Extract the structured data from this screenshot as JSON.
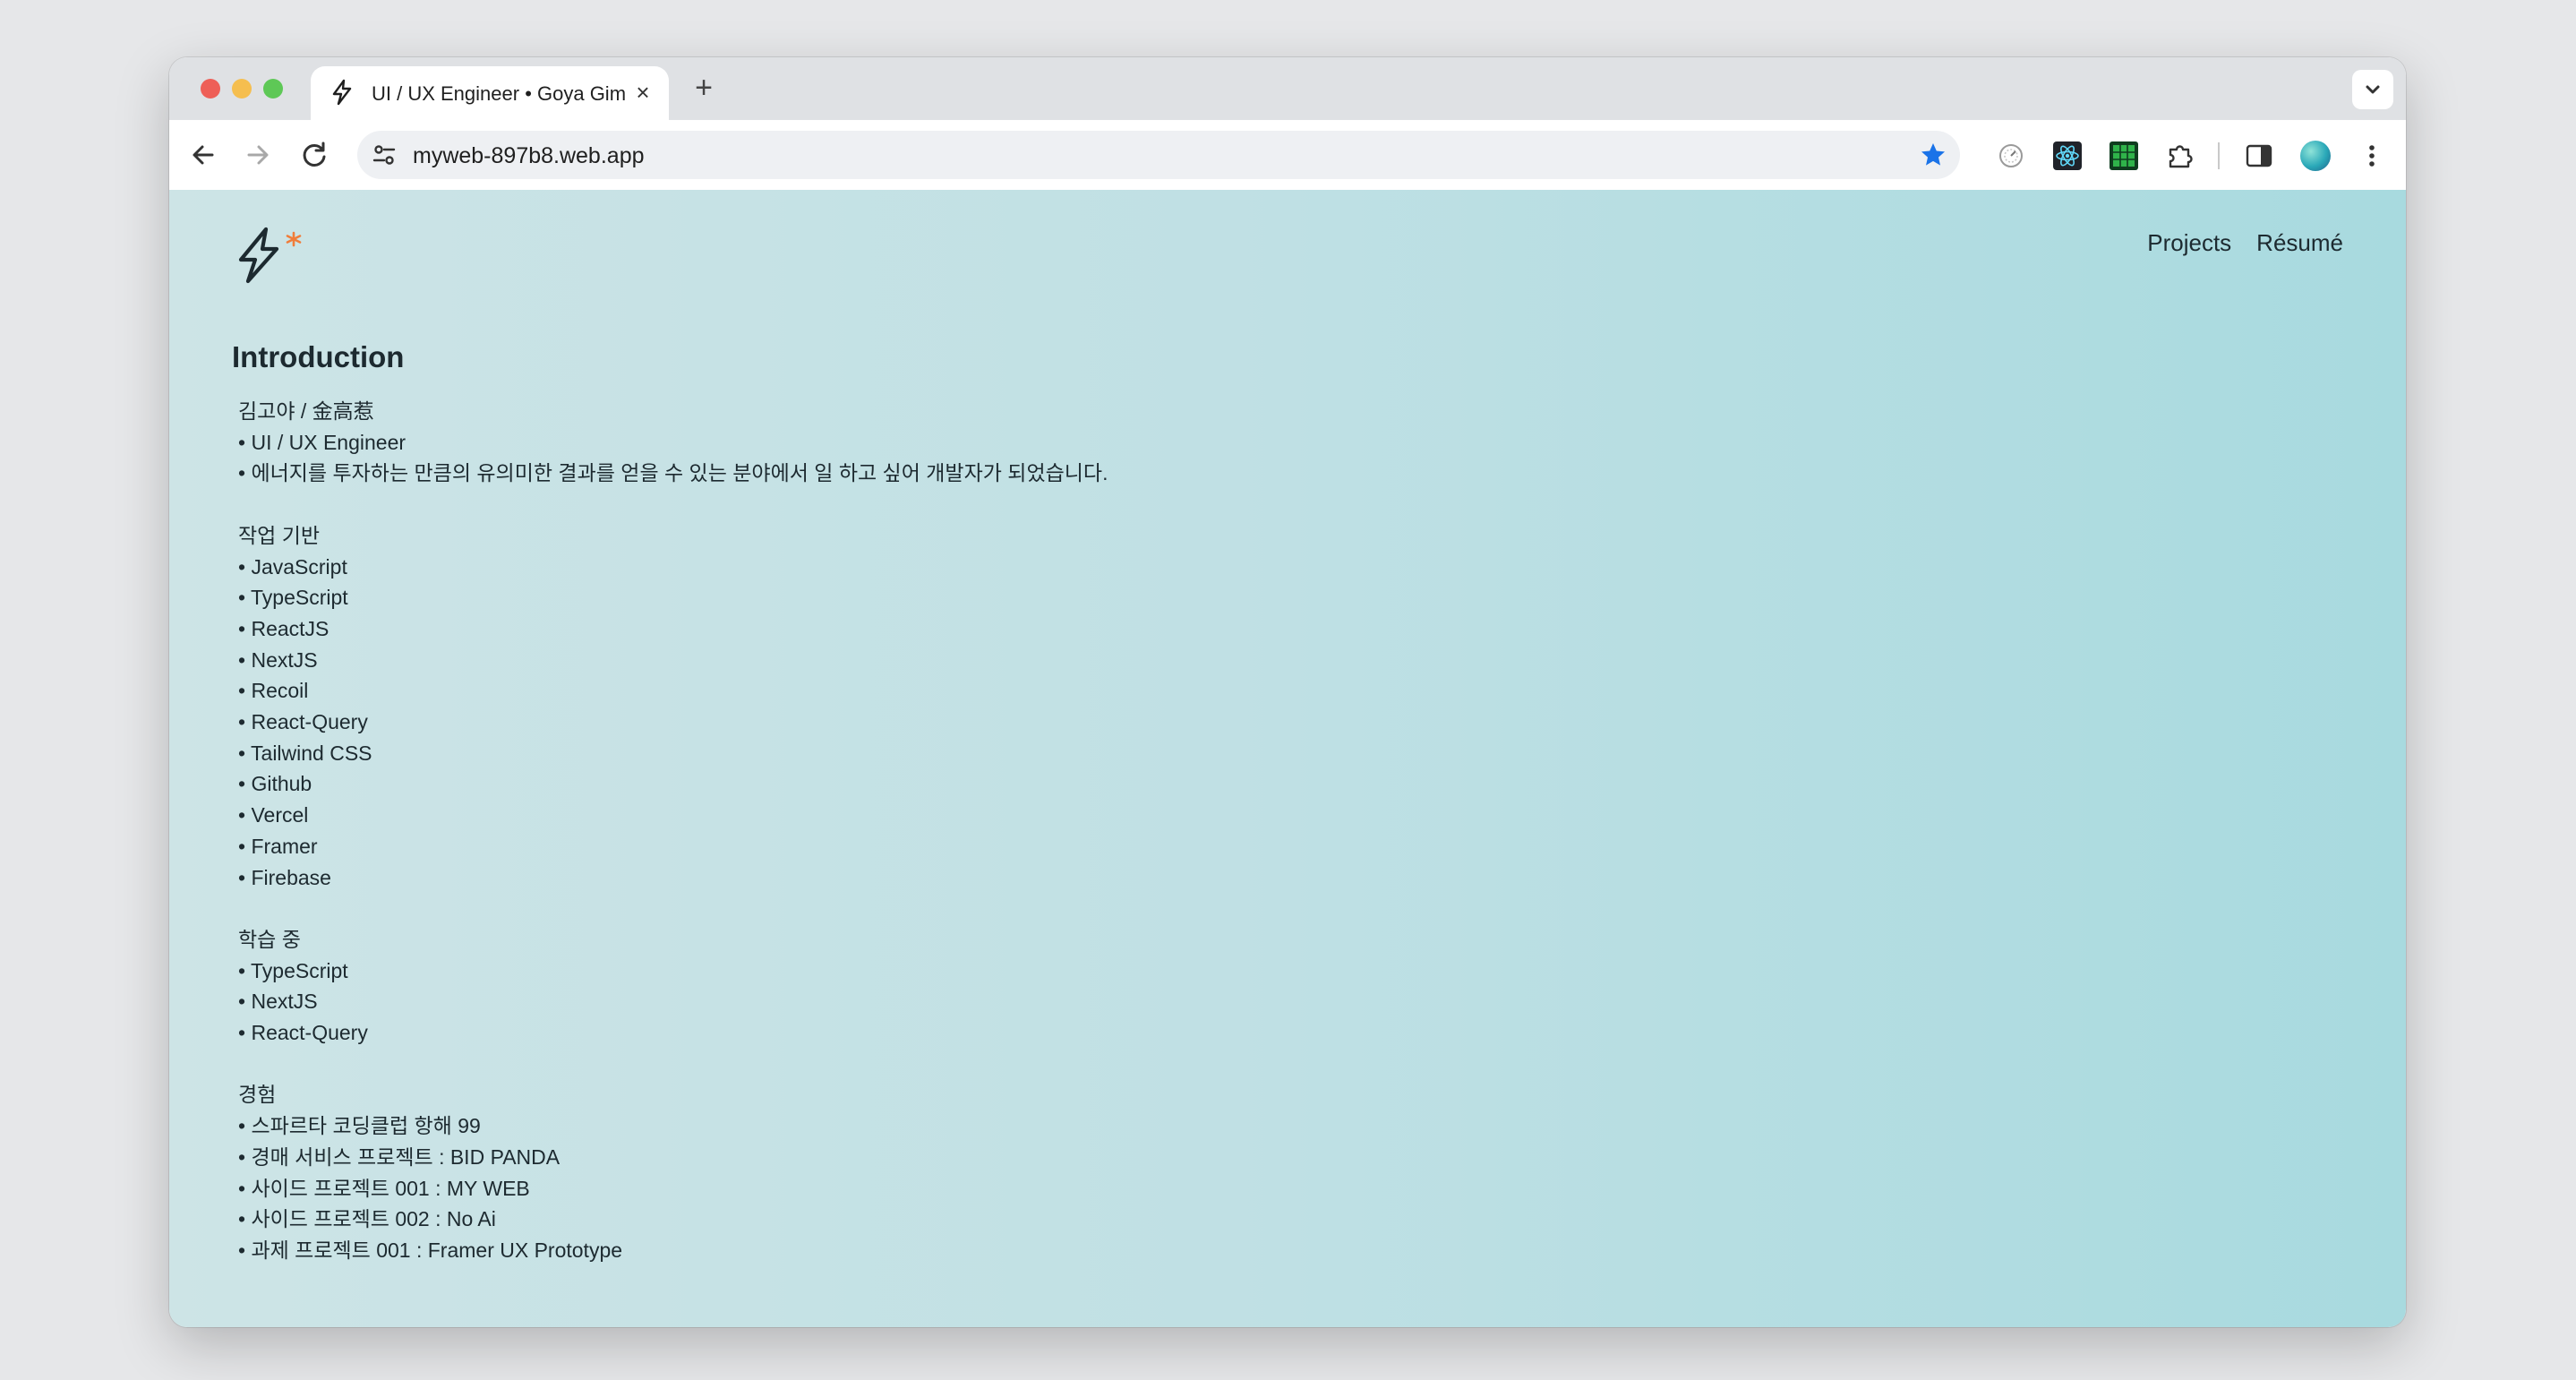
{
  "browser": {
    "tab_title": "UI / UX Engineer • Goya Gim",
    "url": "myweb-897b8.web.app"
  },
  "header": {
    "nav": [
      "Projects",
      "Résumé"
    ]
  },
  "main": {
    "title": "Introduction",
    "sections": [
      {
        "title": "김고야 / 金高惹",
        "items": [
          "UI / UX Engineer",
          "에너지를 투자하는 만큼의 유의미한 결과를 얻을 수 있는 분야에서 일 하고 싶어 개발자가 되었습니다."
        ]
      },
      {
        "title": "작업 기반",
        "items": [
          "JavaScript",
          "TypeScript",
          "ReactJS",
          "NextJS",
          "Recoil",
          "React-Query",
          "Tailwind CSS",
          "Github",
          "Vercel",
          "Framer",
          "Firebase"
        ]
      },
      {
        "title": "학습 중",
        "items": [
          "TypeScript",
          "NextJS",
          "React-Query"
        ]
      },
      {
        "title": "경험",
        "items": [
          "스파르타 코딩클럽 항해 99",
          "경매 서비스 프로젝트 : BID PANDA",
          "사이드 프로젝트 001 : MY WEB",
          "사이드 프로젝트 002 : No Ai",
          "과제 프로젝트 001 : Framer UX Prototype"
        ]
      }
    ]
  },
  "colors": {
    "page_gradient_start": "#cde4e6",
    "page_gradient_end": "#a8dadf",
    "text": "#1d2a30",
    "logo_accent": "#f07d3a",
    "bookmark_star": "#1a73e8"
  },
  "icons": {
    "tab_favicon": "lightning-bolt-icon",
    "site_logo": "lightning-bolt-icon",
    "bookmark": "star-icon"
  }
}
